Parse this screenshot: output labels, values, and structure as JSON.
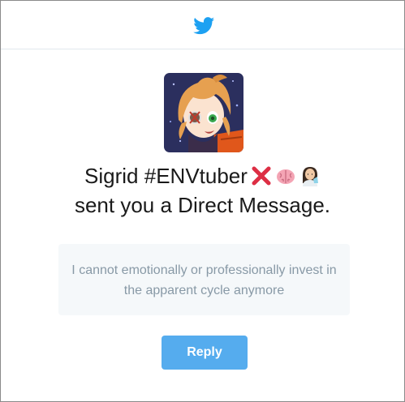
{
  "brand": {
    "logo_icon": "twitter-bird-icon",
    "accent_color": "#1da1f2",
    "button_color": "#55acee"
  },
  "notification": {
    "sender_name": "Sigrid #ENVtuber",
    "sender_emoji_icons": [
      "cross-mark-icon",
      "brain-icon",
      "woman-scientist-icon"
    ],
    "action_text": "sent you a Direct Message.",
    "message": "I cannot emotionally or professionally invest in the apparent cycle anymore"
  },
  "actions": {
    "reply_label": "Reply"
  }
}
